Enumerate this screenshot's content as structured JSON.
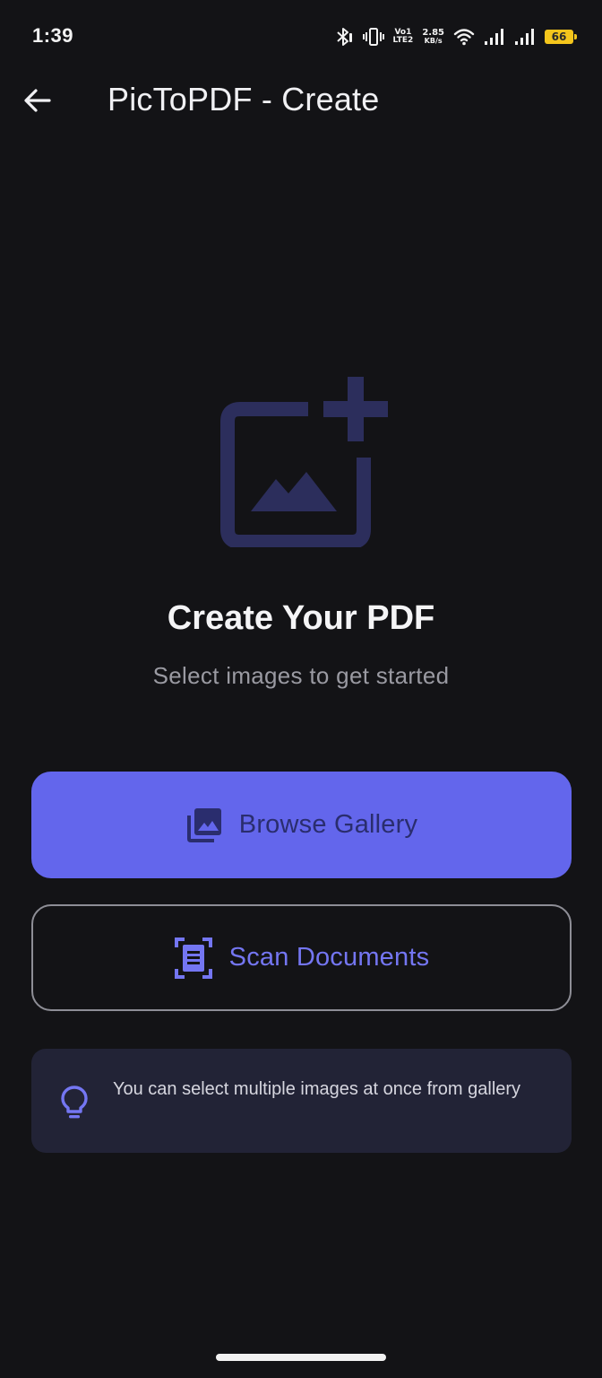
{
  "status_bar": {
    "time": "1:39",
    "network_label_top": "Vo1",
    "network_label_bottom": "LTE2",
    "speed_value": "2.85",
    "speed_unit": "KB/s",
    "battery_level": "66",
    "icons": [
      "bluetooth-icon",
      "vibrate-icon",
      "wifi-icon",
      "signal-icon",
      "signal-icon",
      "battery-icon"
    ]
  },
  "app_bar": {
    "title": "PicToPDF - Create",
    "back_icon": "arrow-left-icon"
  },
  "hero": {
    "icon": "add-image-icon",
    "title": "Create Your PDF",
    "subtitle": "Select images to get started"
  },
  "actions": {
    "browse_label": "Browse Gallery",
    "browse_icon": "photo-library-icon",
    "scan_label": "Scan Documents",
    "scan_icon": "document-scanner-icon"
  },
  "tip": {
    "icon": "lightbulb-icon",
    "text": "You can select multiple images at once from gallery"
  },
  "colors": {
    "background": "#131316",
    "primary": "#6366ec",
    "primary_text": "#2a2d6e",
    "accent_text": "#7476f2",
    "hero_icon": "#2c2e5c",
    "tip_background": "#222336"
  }
}
